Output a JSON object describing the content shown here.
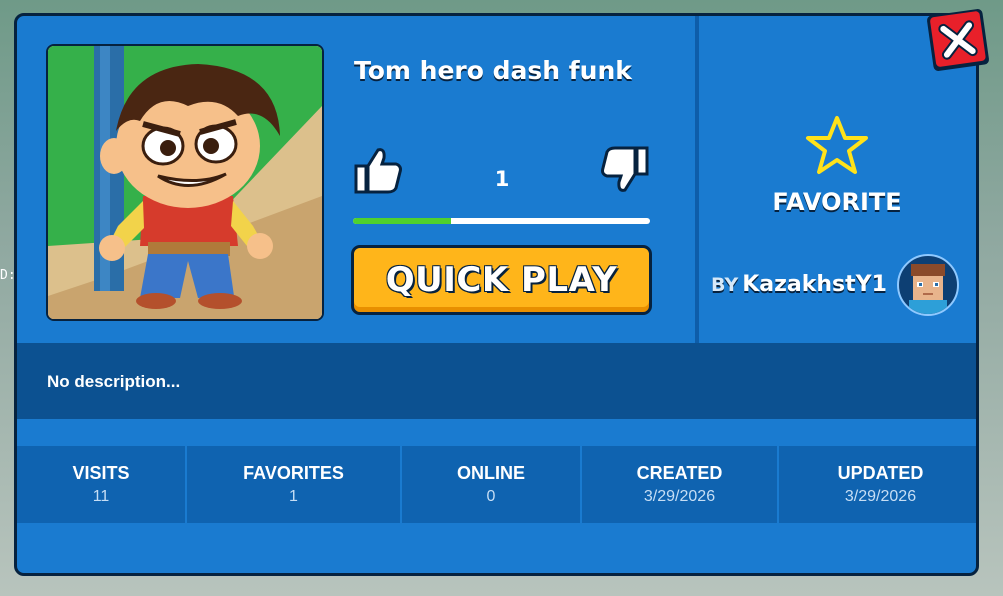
{
  "game": {
    "title": "Tom hero dash funk",
    "thumbnail_icon": "cartoon-boy-thumbnail"
  },
  "voting": {
    "count": "1",
    "like_icon": "thumbs-up-icon",
    "dislike_icon": "thumbs-down-icon",
    "like_ratio": 0.33
  },
  "actions": {
    "quick_play_label": "QUICK PLAY",
    "favorite_label": "FAVORITE",
    "close_icon": "close-x-icon"
  },
  "creator": {
    "by_label": "BY",
    "name": "KazakhstY1"
  },
  "description": "No description...",
  "stats": [
    {
      "label": "VISITS",
      "value": "11"
    },
    {
      "label": "FAVORITES",
      "value": "1"
    },
    {
      "label": "ONLINE",
      "value": "0"
    },
    {
      "label": "CREATED",
      "value": "3/29/2026"
    },
    {
      "label": "UPDATED",
      "value": "3/29/2026"
    }
  ],
  "colors": {
    "panel": "#1a7bd0",
    "quick_play": "#ffb51a",
    "close": "#e8202a",
    "vote_bar_fill": "#4fd12e",
    "star_outline": "#ffe21a"
  },
  "background_fragment": "D:"
}
